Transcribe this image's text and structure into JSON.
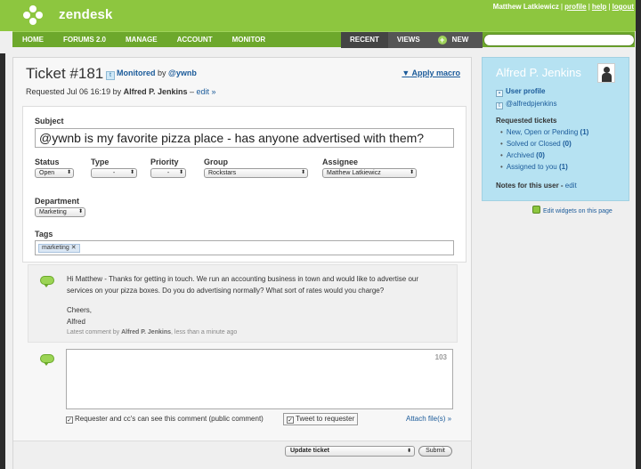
{
  "header": {
    "brand": "zendesk",
    "user_name": "Matthew Latkiewicz",
    "links": [
      "profile",
      "help",
      "logout"
    ]
  },
  "nav": {
    "left": [
      "HOME",
      "FORUMS 2.0",
      "MANAGE",
      "ACCOUNT",
      "MONITOR"
    ],
    "right": [
      "RECENT",
      "VIEWS",
      "NEW"
    ],
    "search_placeholder": ""
  },
  "ticket": {
    "title": "Ticket #181",
    "monitored_prefix": "Monitored",
    "monitored_by": "by",
    "monitor_handle": "@ywnb",
    "apply_macro": "Apply macro",
    "requested_prefix": "Requested Jul 06 16:19 by",
    "requester": "Alfred P. Jenkins",
    "edit_link": "edit »"
  },
  "form": {
    "subject_label": "Subject",
    "subject_value": "@ywnb is my favorite pizza place - has anyone advertised with them?",
    "status_label": "Status",
    "status_value": "Open",
    "type_label": "Type",
    "type_value": "-",
    "priority_label": "Priority",
    "priority_value": "-",
    "group_label": "Group",
    "group_value": "Rockstars",
    "assignee_label": "Assignee",
    "assignee_value": "Matthew Latkiewicz",
    "department_label": "Department",
    "department_value": "Marketing",
    "tags_label": "Tags",
    "tag_value": "marketing"
  },
  "comment": {
    "line1": "Hi Matthew - Thanks for getting in touch. We run an accounting business in town and would like to advertise our",
    "line2": "services on your pizza boxes. Do you do advertising normally? What sort of rates would you charge?",
    "line3": "Cheers,",
    "line4": "Alfred",
    "meta_prefix": "Latest comment by",
    "meta_author": "Alfred P. Jenkins",
    "meta_suffix": ", less than a minute ago"
  },
  "new_comment": {
    "char_count": "103",
    "public_label": "Requester and cc's can see this comment (public comment)",
    "tweet_label": "Tweet to requester",
    "attach_label": "Attach file(s) »"
  },
  "footer": {
    "update_value": "Update ticket",
    "submit_label": "Submit"
  },
  "sidebar": {
    "name": "Alfred P. Jenkins",
    "user_profile": "User profile",
    "twitter": "@alfredpjenkins",
    "requested_heading": "Requested tickets",
    "items": [
      {
        "label": "New, Open or Pending",
        "count": "(1)"
      },
      {
        "label": "Solved or Closed",
        "count": "(0)"
      },
      {
        "label": "Archived",
        "count": "(0)"
      },
      {
        "label": "Assigned to you",
        "count": "(1)"
      }
    ],
    "notes_label": "Notes for this user",
    "notes_edit": "edit",
    "edit_widgets": "Edit widgets on this page"
  }
}
